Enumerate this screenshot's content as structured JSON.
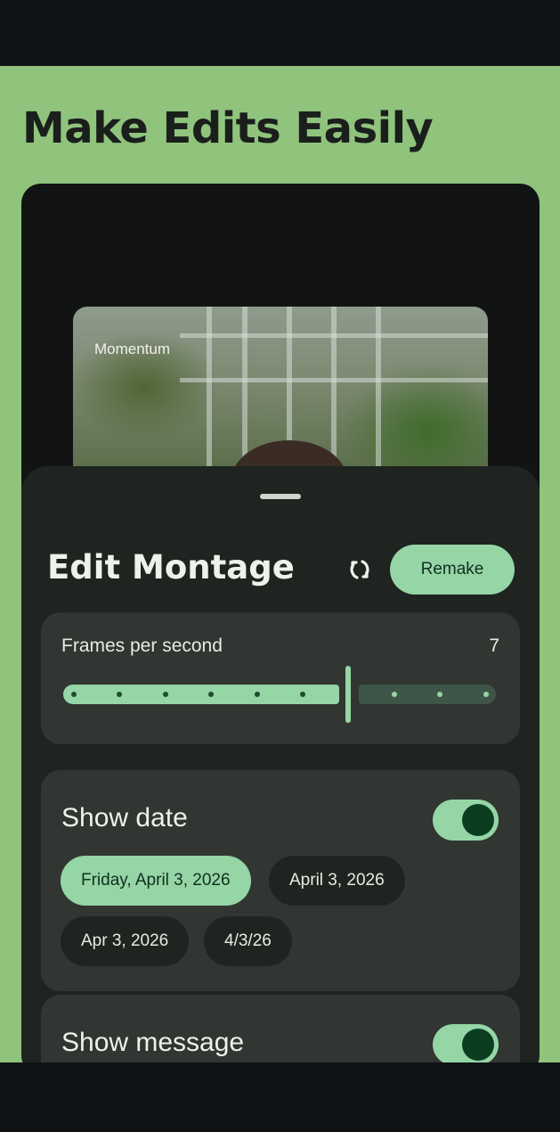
{
  "theme": {
    "background_green": "#90c47c",
    "accent": "#95d5a6"
  },
  "headline": "Make Edits Easily",
  "preview": {
    "label": "Momentum"
  },
  "sheet": {
    "title": "Edit Montage",
    "refresh_icon": "refresh-icon",
    "remake_label": "Remake"
  },
  "fps": {
    "label": "Frames per second",
    "value": "7",
    "current_step": 7,
    "steps": 10
  },
  "show_date": {
    "label": "Show date",
    "enabled": true,
    "options": [
      {
        "label": "Friday, April 3, 2026",
        "selected": true
      },
      {
        "label": "April 3, 2026",
        "selected": false
      },
      {
        "label": "Apr 3, 2026",
        "selected": false
      },
      {
        "label": "4/3/26",
        "selected": false
      }
    ]
  },
  "show_message": {
    "label": "Show message",
    "enabled": true
  }
}
